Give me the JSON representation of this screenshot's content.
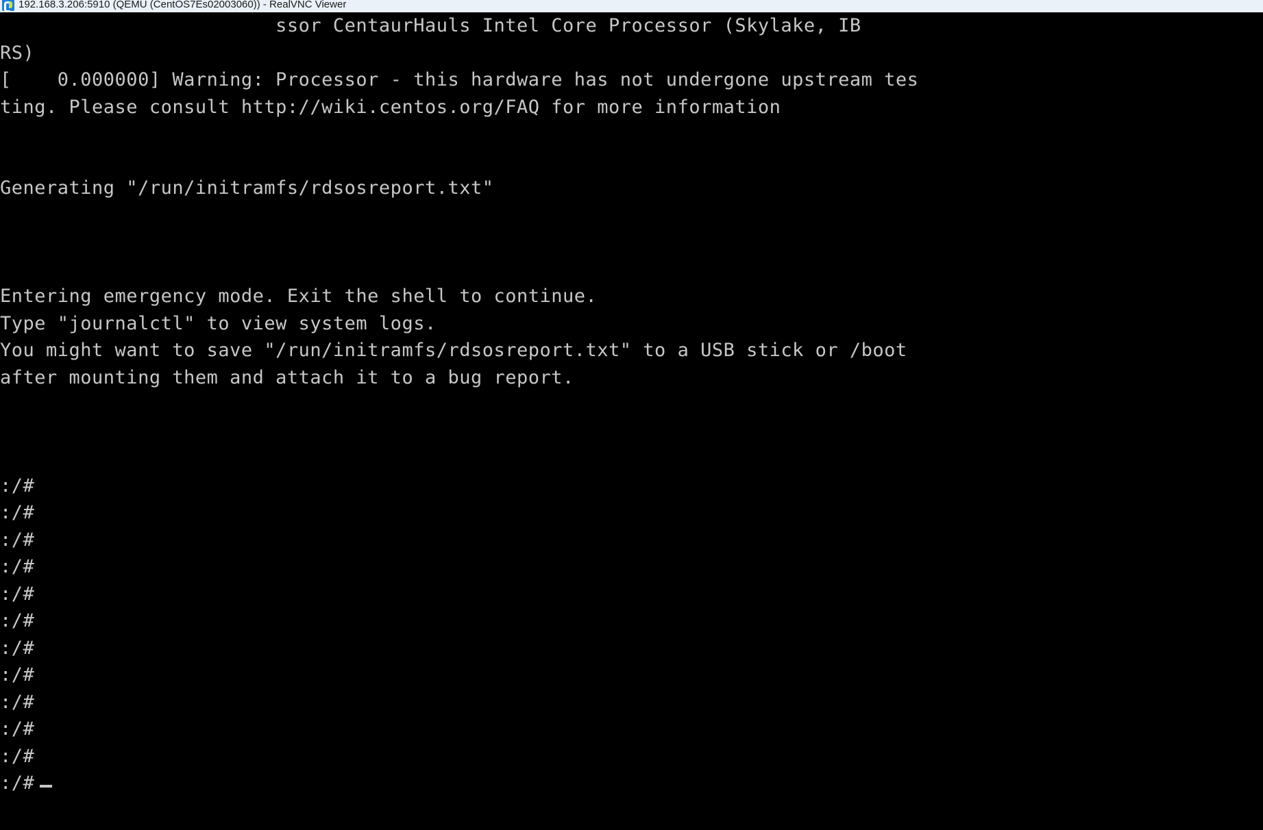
{
  "window": {
    "title": "192.168.3.206:5910 (QEMU (CentOS7Es02003060)) - RealVNC Viewer",
    "icon": "realvnc-logo-icon",
    "titlebar_bg": "#eaf1f8",
    "titlebar_text_color": "#1a1a1a"
  },
  "console": {
    "bg": "#000000",
    "fg": "#c7c7c7",
    "cursor": "_",
    "lines": [
      "                        ssor CentaurHauls Intel Core Processor (Skylake, IB",
      "RS)",
      "[    0.000000] Warning: Processor - this hardware has not undergone upstream tes",
      "ting. Please consult http://wiki.centos.org/FAQ for more information",
      "",
      "",
      "Generating \"/run/initramfs/rdsosreport.txt\"",
      "",
      "",
      "",
      "Entering emergency mode. Exit the shell to continue.",
      "Type \"journalctl\" to view system logs.",
      "You might want to save \"/run/initramfs/rdsosreport.txt\" to a USB stick or /boot",
      "after mounting them and attach it to a bug report.",
      "",
      "",
      "",
      ":/#",
      ":/#",
      ":/#",
      ":/#",
      ":/#",
      ":/#",
      ":/#",
      ":/#",
      ":/#",
      ":/#",
      ":/#",
      ":/#"
    ],
    "last_prompt": ":/# "
  }
}
